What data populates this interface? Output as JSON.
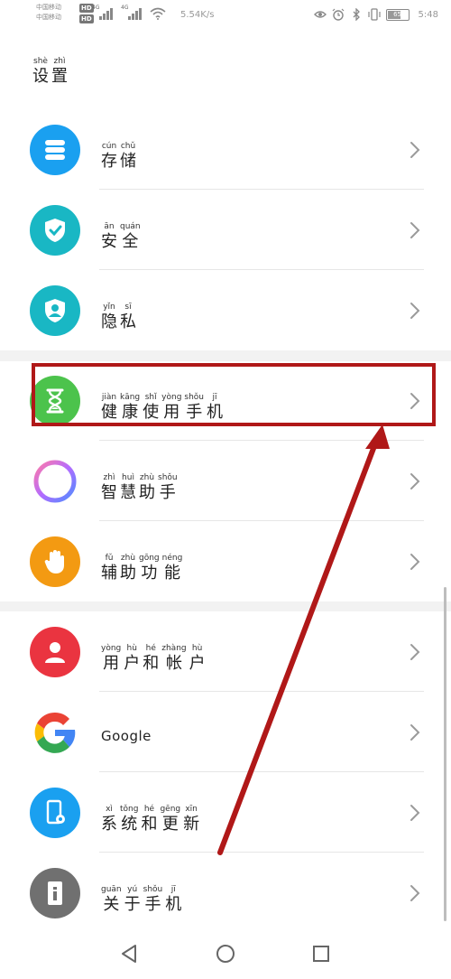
{
  "status_bar": {
    "carrier_line1": "中国移动",
    "carrier_line2": "中国移动",
    "hd1": "HD",
    "hd2": "HD",
    "signal1": "4G",
    "signal2": "4G",
    "net_speed": "5.54K/s",
    "battery": "65",
    "time": "5:48"
  },
  "page": {
    "title": [
      {
        "py": "shè",
        "hz": "设"
      },
      {
        "py": "zhì",
        "hz": "置"
      }
    ]
  },
  "settings": {
    "items": [
      {
        "icon": "storage-icon",
        "color": "#1aa0f0",
        "chars": [
          {
            "py": "cún",
            "hz": "存"
          },
          {
            "py": "chǔ",
            "hz": "储"
          }
        ]
      },
      {
        "icon": "security-shield-icon",
        "color": "#19b7c4",
        "chars": [
          {
            "py": "ān",
            "hz": "安"
          },
          {
            "py": "quán",
            "hz": "全"
          }
        ]
      },
      {
        "icon": "privacy-icon",
        "color": "#19b7c4",
        "chars": [
          {
            "py": "yǐn",
            "hz": "隐"
          },
          {
            "py": "sī",
            "hz": "私"
          }
        ]
      },
      {
        "icon": "hourglass-icon",
        "color": "#4cc34c",
        "chars": [
          {
            "py": "jiàn",
            "hz": "健"
          },
          {
            "py": "kāng",
            "hz": "康"
          },
          {
            "py": "shǐ",
            "hz": "使"
          },
          {
            "py": "yòng",
            "hz": "用"
          },
          {
            "py": "shǒu",
            "hz": "手"
          },
          {
            "py": "jī",
            "hz": "机"
          }
        ]
      },
      {
        "icon": "assistant-ring-icon",
        "color": "#ffffff",
        "chars": [
          {
            "py": "zhì",
            "hz": "智"
          },
          {
            "py": "huì",
            "hz": "慧"
          },
          {
            "py": "zhù",
            "hz": "助"
          },
          {
            "py": "shǒu",
            "hz": "手"
          }
        ]
      },
      {
        "icon": "hand-icon",
        "color": "#f39a12",
        "chars": [
          {
            "py": "fǔ",
            "hz": "辅"
          },
          {
            "py": "zhù",
            "hz": "助"
          },
          {
            "py": "gōng",
            "hz": "功"
          },
          {
            "py": "néng",
            "hz": "能"
          }
        ]
      },
      {
        "icon": "user-icon",
        "color": "#ea3440",
        "chars": [
          {
            "py": "yòng",
            "hz": "用"
          },
          {
            "py": "hù",
            "hz": "户"
          },
          {
            "py": "hé",
            "hz": "和"
          },
          {
            "py": "zhàng",
            "hz": "帐"
          },
          {
            "py": "hù",
            "hz": "户"
          }
        ]
      },
      {
        "icon": "google-icon",
        "color": "#ffffff",
        "label": "Google"
      },
      {
        "icon": "system-phone-gear-icon",
        "color": "#1aa0f0",
        "chars": [
          {
            "py": "xì",
            "hz": "系"
          },
          {
            "py": "tǒng",
            "hz": "统"
          },
          {
            "py": "hé",
            "hz": "和"
          },
          {
            "py": "gēng",
            "hz": "更"
          },
          {
            "py": "xīn",
            "hz": "新"
          }
        ]
      },
      {
        "icon": "about-phone-icon",
        "color": "#707070",
        "chars": [
          {
            "py": "guān",
            "hz": "关"
          },
          {
            "py": "yú",
            "hz": "于"
          },
          {
            "py": "shǒu",
            "hz": "手"
          },
          {
            "py": "jī",
            "hz": "机"
          }
        ]
      }
    ]
  },
  "annotation": {
    "color": "#b01818"
  }
}
